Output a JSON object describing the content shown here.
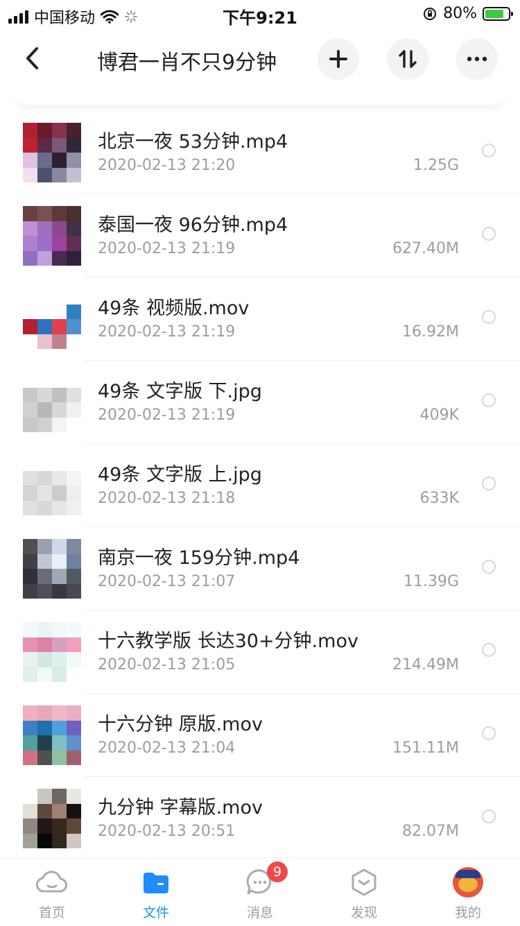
{
  "status_bar": {
    "carrier": "中国移动",
    "time": "下午9:21",
    "battery": "80%",
    "battery_level": 0.8
  },
  "nav": {
    "title": "博君一肖不只9分钟",
    "back_icon": "chevron-left-icon",
    "add_icon": "plus-icon",
    "sort_icon": "sort-icon",
    "more_icon": "more-icon"
  },
  "files": [
    {
      "name": "北京一夜 53分钟.mp4",
      "date": "2020-02-13 21:20",
      "size": "1.25G"
    },
    {
      "name": "泰国一夜 96分钟.mp4",
      "date": "2020-02-13 21:19",
      "size": "627.40M"
    },
    {
      "name": "49条 视频版.mov",
      "date": "2020-02-13 21:19",
      "size": "16.92M"
    },
    {
      "name": "49条 文字版 下.jpg",
      "date": "2020-02-13 21:19",
      "size": "409K"
    },
    {
      "name": "49条 文字版 上.jpg",
      "date": "2020-02-13 21:18",
      "size": "633K"
    },
    {
      "name": "南京一夜 159分钟.mp4",
      "date": "2020-02-13 21:07",
      "size": "11.39G"
    },
    {
      "name": "十六教学版 长达30+分钟.mov",
      "date": "2020-02-13 21:05",
      "size": "214.49M"
    },
    {
      "name": "十六分钟 原版.mov",
      "date": "2020-02-13 21:04",
      "size": "151.11M"
    },
    {
      "name": "九分钟 字幕版.mov",
      "date": "2020-02-13 20:51",
      "size": "82.07M"
    }
  ],
  "tabbar": {
    "tabs": [
      {
        "label": "首页",
        "icon": "cloud-icon"
      },
      {
        "label": "文件",
        "icon": "folder-icon"
      },
      {
        "label": "消息",
        "icon": "message-icon",
        "badge": "9"
      },
      {
        "label": "发现",
        "icon": "discover-icon"
      },
      {
        "label": "我的",
        "icon": "avatar-icon"
      }
    ],
    "active_index": 1
  },
  "colors": {
    "accent": "#1e8cfa",
    "badge": "#f04848",
    "battery": "#3fc742"
  }
}
